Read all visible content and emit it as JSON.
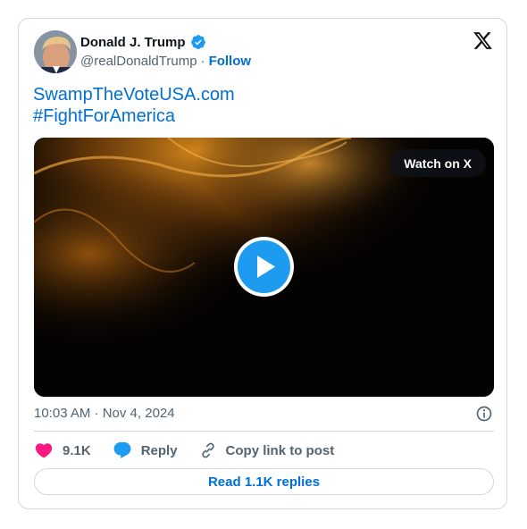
{
  "author": {
    "display_name": "Donald J. Trump",
    "handle": "@realDonaldTrump",
    "separator": "·",
    "follow_label": "Follow",
    "verified_color": "#1d9bf0"
  },
  "post": {
    "lines": [
      "SwampTheVoteUSA.com",
      "#FightForAmerica"
    ],
    "link_color": "#006fd6"
  },
  "media": {
    "watch_label": "Watch on X",
    "play_icon": "play-icon"
  },
  "meta": {
    "timestamp": "10:03 AM · Nov 4, 2024",
    "info_icon": "info-icon"
  },
  "actions": {
    "likes": "9.1K",
    "reply_label": "Reply",
    "copy_label": "Copy link to post",
    "like_color": "#f91880",
    "reply_color": "#1d9bf0"
  },
  "footer": {
    "read_replies_label": "Read 1.1K replies"
  },
  "icons": {
    "brand": "x-logo-icon",
    "heart": "heart-icon",
    "reply": "reply-bubble-icon",
    "link": "link-icon"
  }
}
